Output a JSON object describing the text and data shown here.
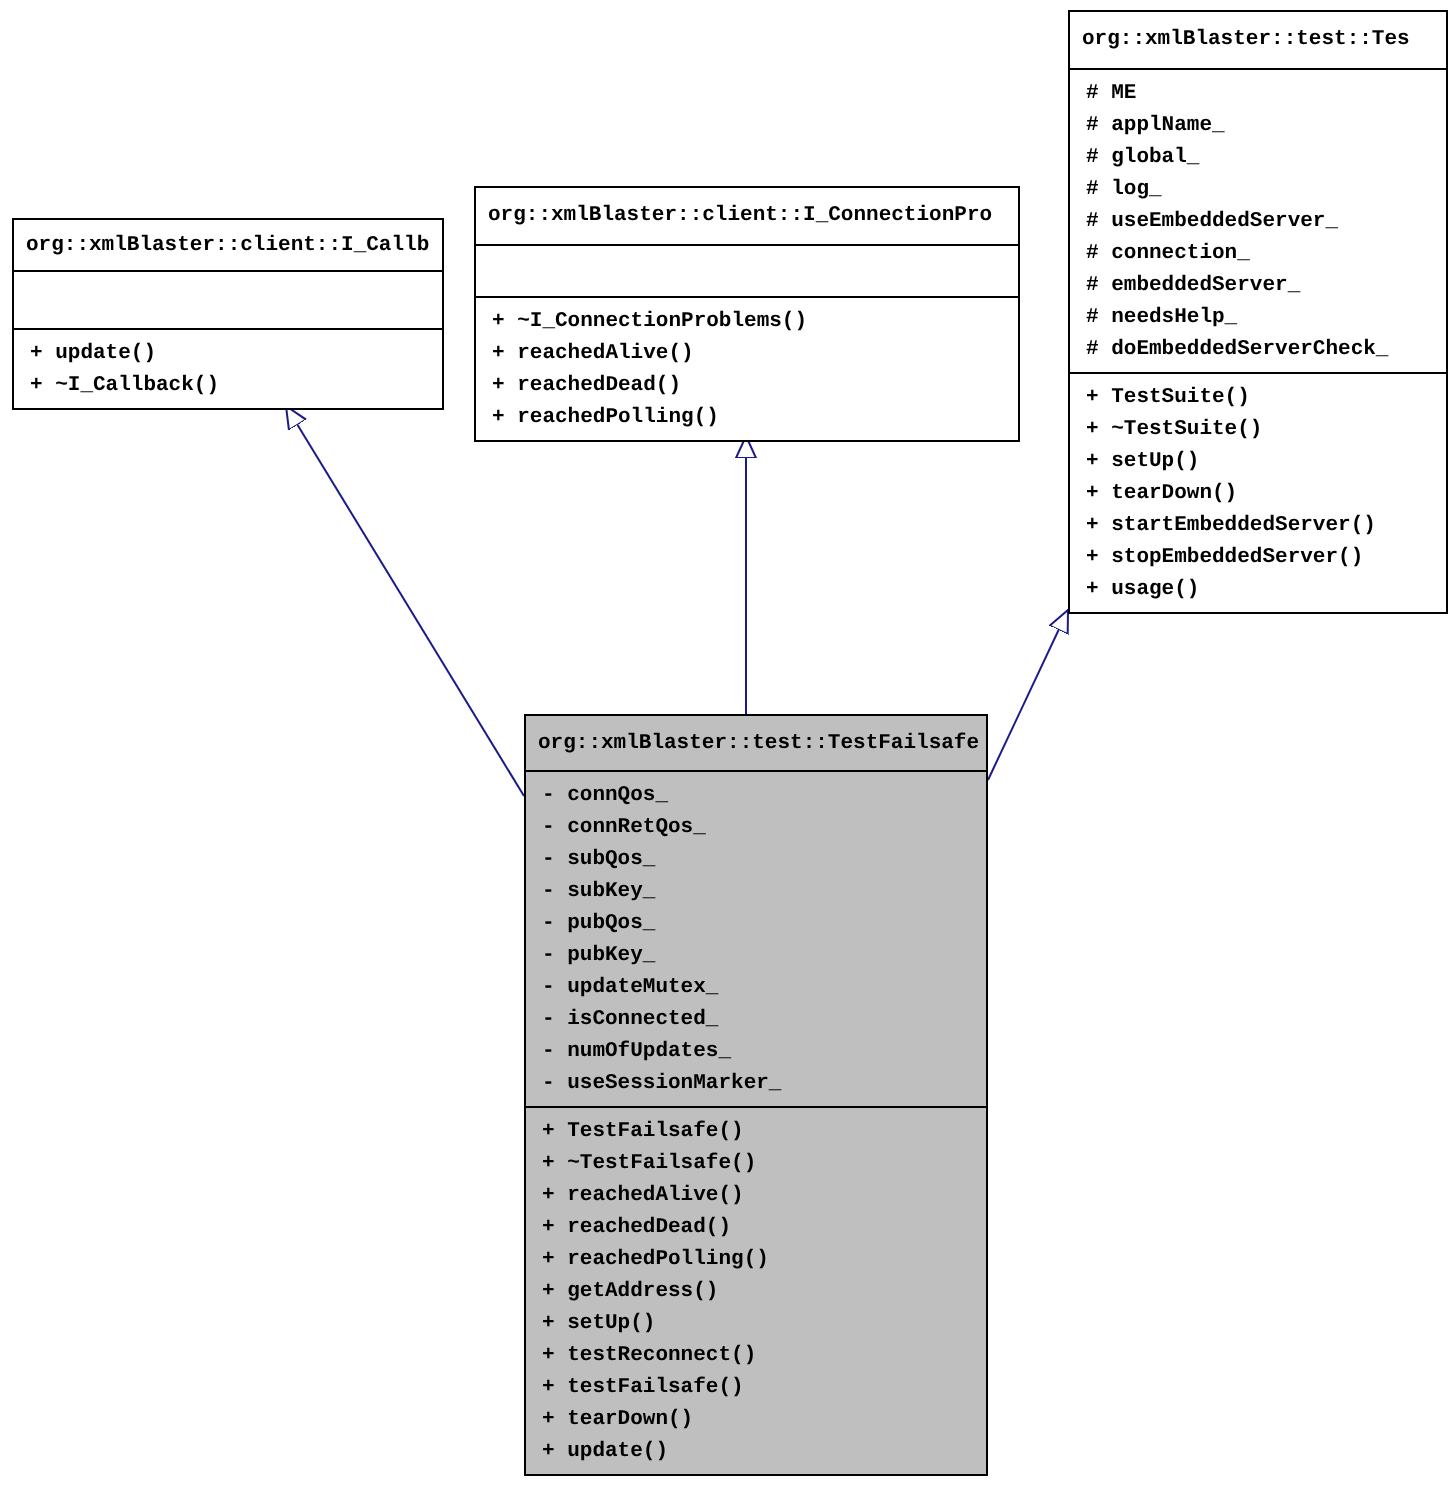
{
  "classes": [
    {
      "kind": "base",
      "title": "org::xmlBlaster::client::I_Callb",
      "methods": [
        "+ update()",
        "+ ~I_Callback()"
      ]
    },
    {
      "kind": "base",
      "title": "org::xmlBlaster::client::I_ConnectionPro",
      "methods": [
        "+ ~I_ConnectionProblems()",
        "+ reachedAlive()",
        "+ reachedDead()",
        "+ reachedPolling()"
      ]
    },
    {
      "kind": "base",
      "title": "org::xmlBlaster::test::Tes",
      "attributes": [
        "# ME",
        "# applName_",
        "# global_",
        "# log_",
        "# useEmbeddedServer_",
        "# connection_",
        "# embeddedServer_",
        "# needsHelp_",
        "# doEmbeddedServerCheck_"
      ],
      "methods": [
        "+ TestSuite()",
        "+ ~TestSuite()",
        "+ setUp()",
        "+ tearDown()",
        "+ startEmbeddedServer()",
        "+ stopEmbeddedServer()",
        "+ usage()"
      ]
    },
    {
      "kind": "current",
      "title": "org::xmlBlaster::test::TestFailsafe",
      "attributes": [
        "- connQos_",
        "- connRetQos_",
        "- subQos_",
        "- subKey_",
        "- pubQos_",
        "- pubKey_",
        "- updateMutex_",
        "- isConnected_",
        "- numOfUpdates_",
        "- useSessionMarker_"
      ],
      "methods": [
        "+ TestFailsafe()",
        "+ ~TestFailsafe()",
        "+ reachedAlive()",
        "+ reachedDead()",
        "+ reachedPolling()",
        "+ getAddress()",
        "+ setUp()",
        "+ testReconnect()",
        "+ testFailsafe()",
        "+ tearDown()",
        "+ update()"
      ]
    }
  ]
}
